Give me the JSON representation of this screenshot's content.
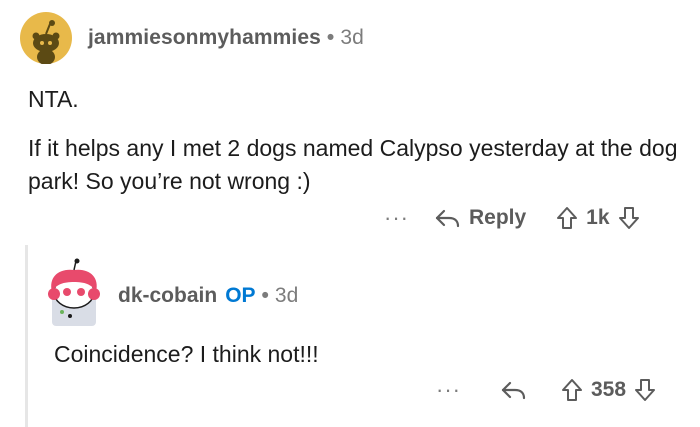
{
  "parent_comment": {
    "username": "jammiesonmyhammies",
    "age": "3d",
    "text_line1": "NTA.",
    "text_body": "If it helps any I met 2 dogs named Calypso yesterday at the dog park! So you’re not wrong :)",
    "actions": {
      "more_label": "···",
      "reply_label": "Reply",
      "vote_count": "1k",
      "reply_icon": "reply-arrow-icon",
      "upvote_icon": "upvote-arrow-icon",
      "downvote_icon": "downvote-arrow-icon"
    }
  },
  "child_comment": {
    "username": "dk-cobain",
    "badge": "OP",
    "age": "3d",
    "text": "Coincidence? I think not!!!",
    "actions": {
      "more_label": "···",
      "vote_count": "358",
      "reply_icon": "reply-arrow-icon",
      "upvote_icon": "upvote-arrow-icon",
      "downvote_icon": "downvote-arrow-icon"
    }
  },
  "meta_separator": "•",
  "colors": {
    "op_badge": "#0079d3",
    "meta_text": "#5c5c5c",
    "thread_line": "#e6e6e6",
    "avatar1_bg": "#e8b94a",
    "avatar2_accent": "#e84a6c"
  }
}
